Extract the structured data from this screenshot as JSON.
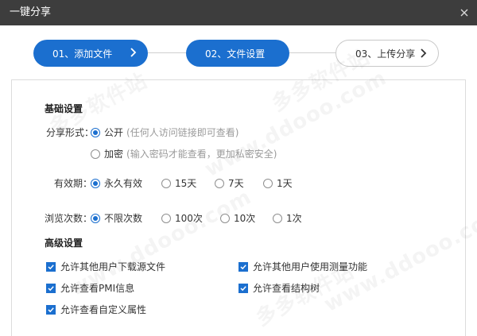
{
  "dialog": {
    "title": "一键分享",
    "close_icon": "close-icon"
  },
  "steps": [
    {
      "label": "01、添加文件",
      "state": "done"
    },
    {
      "label": "02、文件设置",
      "state": "current"
    },
    {
      "label": "03、上传分享",
      "state": "pending"
    }
  ],
  "colors": {
    "accent": "#1b6fcf",
    "titlebar": "#3d3d3d",
    "hint": "#9a9a9a"
  },
  "basic": {
    "title": "基础设置",
    "share_type": {
      "label": "分享形式：",
      "options": [
        {
          "label": "公开",
          "hint": "(任何人访问链接即可查看)",
          "selected": true
        },
        {
          "label": "加密",
          "hint": "(输入密码才能查看，更加私密安全)",
          "selected": false
        }
      ]
    },
    "validity": {
      "label": "有效期：",
      "options": [
        {
          "label": "永久有效",
          "selected": true
        },
        {
          "label": "15天",
          "selected": false
        },
        {
          "label": "7天",
          "selected": false
        },
        {
          "label": "1天",
          "selected": false
        }
      ]
    },
    "views": {
      "label": "浏览次数：",
      "options": [
        {
          "label": "不限次数",
          "selected": true
        },
        {
          "label": "100次",
          "selected": false
        },
        {
          "label": "10次",
          "selected": false
        },
        {
          "label": "1次",
          "selected": false
        }
      ]
    }
  },
  "advanced": {
    "title": "高级设置",
    "options": [
      {
        "label": "允许其他用户下载源文件",
        "checked": true
      },
      {
        "label": "允许其他用户使用测量功能",
        "checked": true
      },
      {
        "label": "允许查看PMI信息",
        "checked": true
      },
      {
        "label": "允许查看结构树",
        "checked": true
      },
      {
        "label": "允许查看自定义属性",
        "checked": true
      }
    ]
  }
}
